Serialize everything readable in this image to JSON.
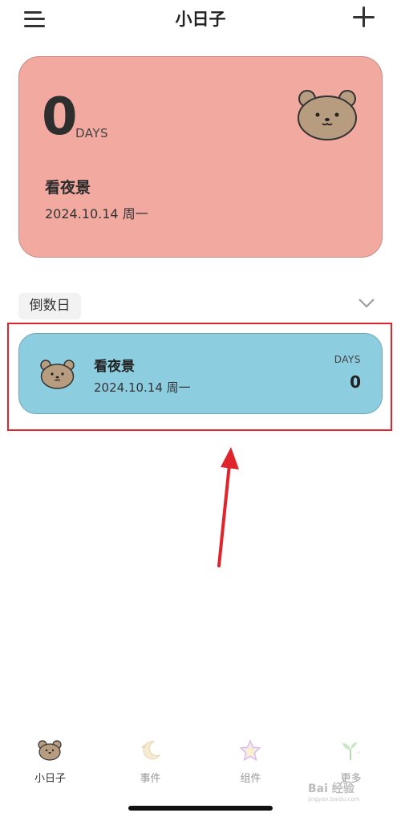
{
  "header": {
    "title": "小日子"
  },
  "hero": {
    "count": "0",
    "unit": "DAYS",
    "event_name": "看夜景",
    "date": "2024.10.14 周一",
    "bg_color": "#f1a9a0",
    "icon": "bear-face-icon"
  },
  "section": {
    "label": "倒数日",
    "toggle_icon": "chevron-down-icon"
  },
  "event_card": {
    "event_name": "看夜景",
    "date": "2024.10.14 周一",
    "unit": "DAYS",
    "count": "0",
    "bg_color": "#8ccde0",
    "icon": "bear-face-icon"
  },
  "annotation": {
    "highlight_color": "#e0242c"
  },
  "tabbar": {
    "tabs": [
      {
        "label": "小日子",
        "icon": "bear-icon",
        "active": true
      },
      {
        "label": "事件",
        "icon": "moon-icon",
        "active": false
      },
      {
        "label": "组件",
        "icon": "star-icon",
        "active": false
      },
      {
        "label": "更多",
        "icon": "sprout-icon",
        "active": false
      }
    ]
  },
  "watermark": {
    "text": "Bai 经验",
    "sub": "jingyan.baidu.com"
  }
}
